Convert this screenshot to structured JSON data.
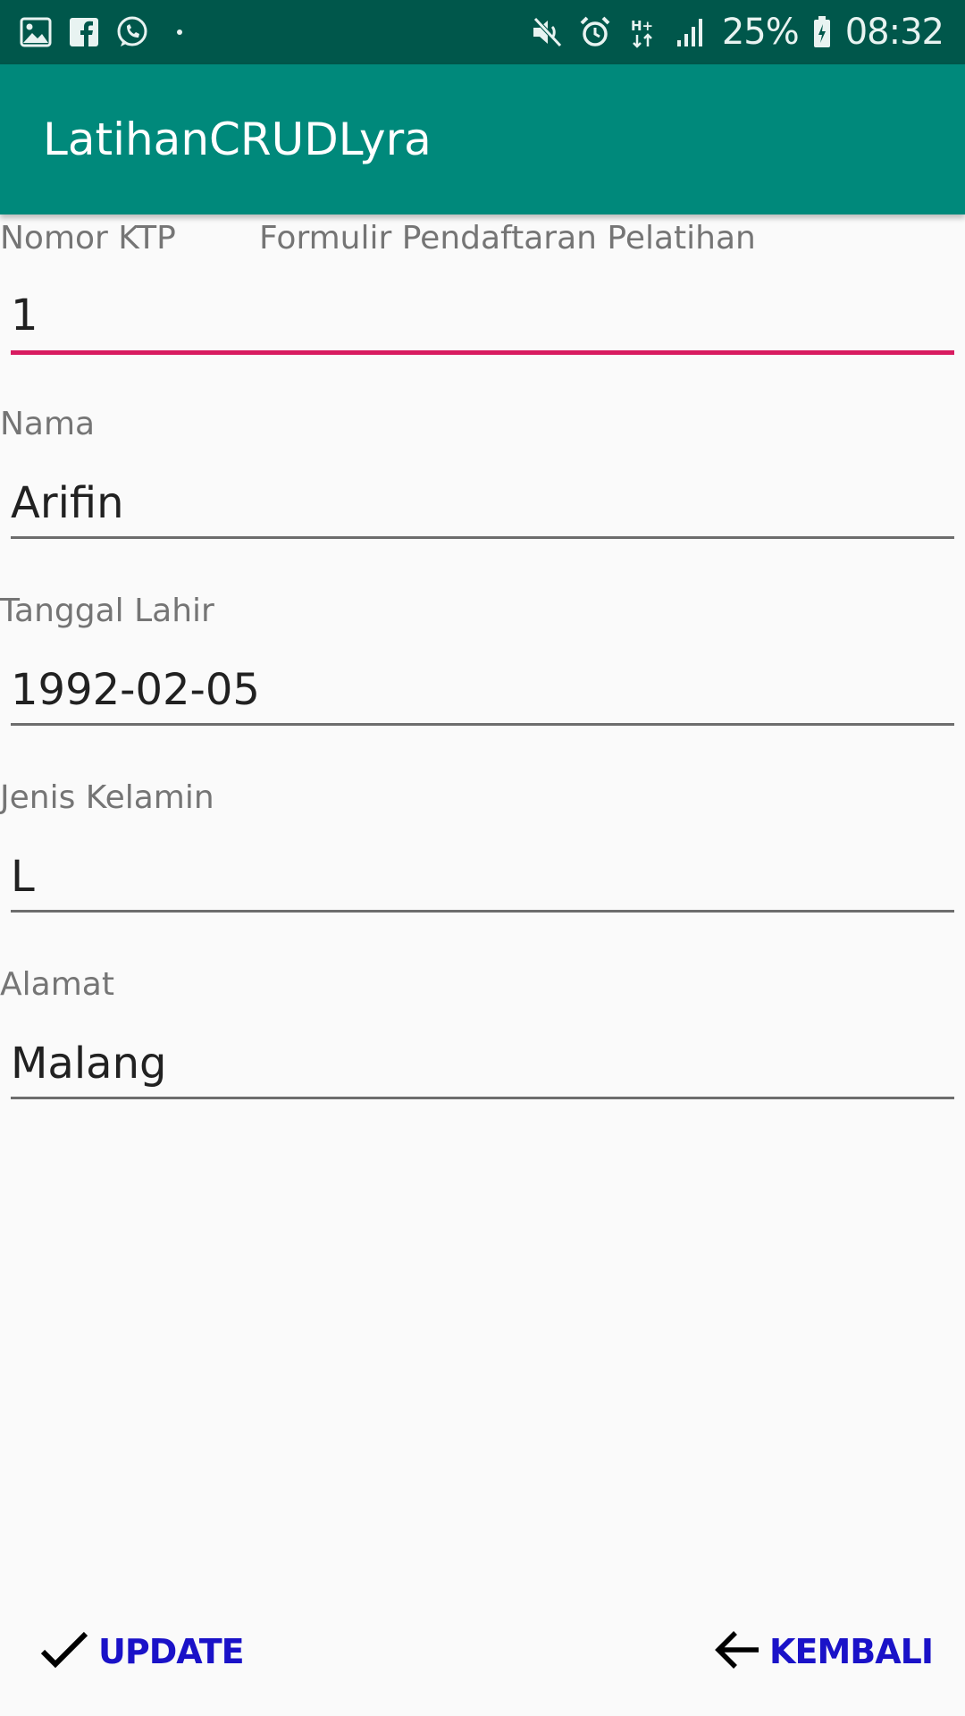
{
  "status_bar": {
    "battery": "25%",
    "time": "08:32",
    "left_icons": [
      "image-icon",
      "facebook-icon",
      "whatsapp-icon"
    ],
    "right_icons": [
      "mute-icon",
      "alarm-icon",
      "data-icon",
      "signal-icon",
      "battery-icon"
    ]
  },
  "app_bar": {
    "title": "LatihanCRUDLyra"
  },
  "form": {
    "title": "Formulir Pendaftaran Pelatihan",
    "fields": [
      {
        "label": "Nomor KTP",
        "value": "1"
      },
      {
        "label": "Nama",
        "value": "Arifin"
      },
      {
        "label": "Tanggal Lahir",
        "value": "1992-02-05"
      },
      {
        "label": "Jenis Kelamin",
        "value": "L"
      },
      {
        "label": "Alamat",
        "value": "Malang"
      }
    ]
  },
  "actions": {
    "update_label": "UPDATE",
    "back_label": "KEMBALI"
  },
  "colors": {
    "status_bar": "#00574b",
    "app_bar": "#00897b",
    "focus_underline": "#d81b60",
    "button_text": "#1a12c8"
  }
}
